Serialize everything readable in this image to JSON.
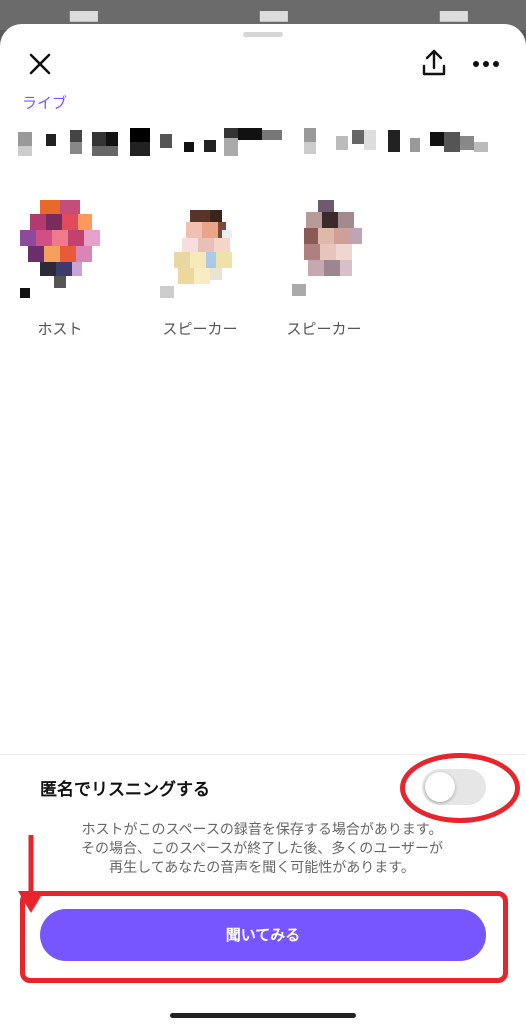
{
  "sheet": {
    "live_label": "ライブ"
  },
  "participants": [
    {
      "role": "ホスト"
    },
    {
      "role": "スピーカー"
    },
    {
      "role": "スピーカー"
    }
  ],
  "anonymous": {
    "label": "匿名でリスニングする",
    "enabled": false
  },
  "note_lines": [
    "ホストがこのスペースの録音を保存する場合があります。",
    "その場合、このスペースが終了した後、多くのユーザーが",
    "再生してあなたの音声を聞く可能性があります。"
  ],
  "listen_button": {
    "label": "聞いてみる"
  },
  "colors": {
    "accent": "#7856ff",
    "annotation": "#e8242c"
  },
  "icons": [
    "close-icon",
    "share-icon",
    "more-icon",
    "down-arrow-icon"
  ]
}
